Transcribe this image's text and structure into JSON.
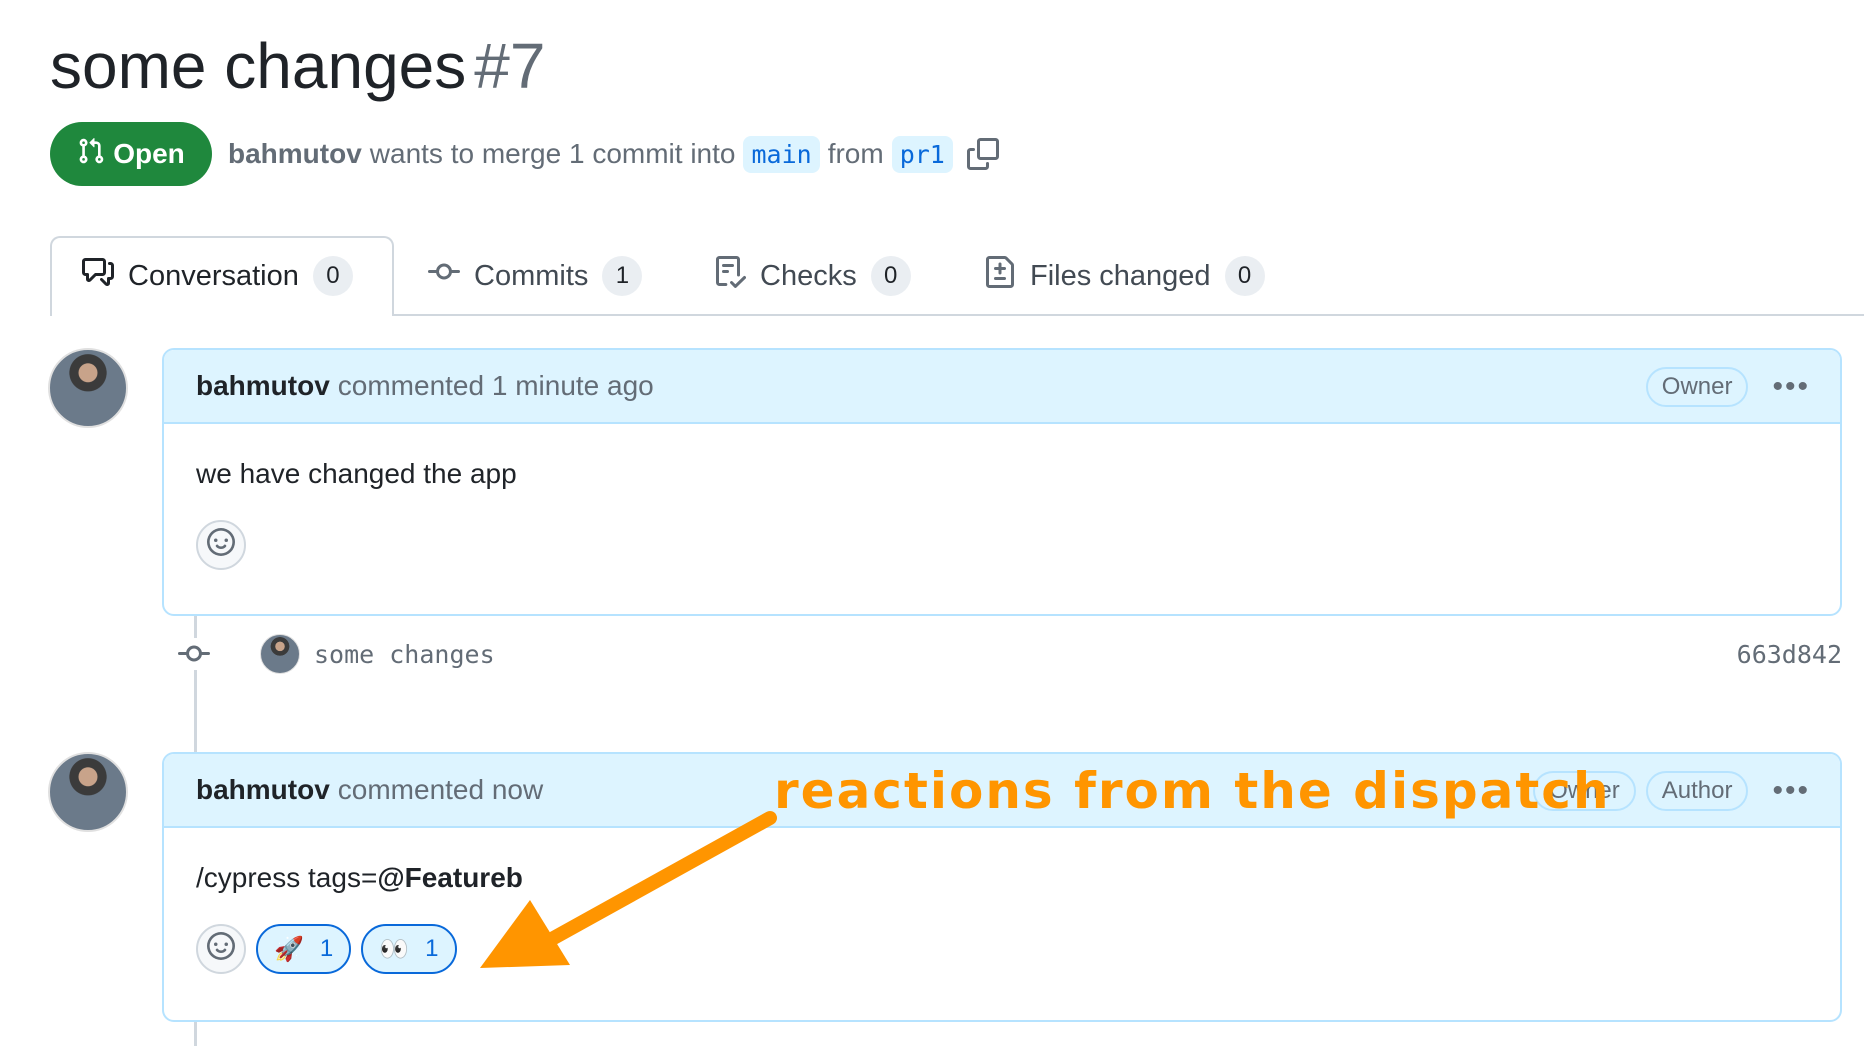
{
  "pr": {
    "title": "some changes",
    "number": "#7",
    "state": "Open",
    "author": "bahmutov",
    "merge_text": "wants to merge 1 commit into",
    "base_branch": "main",
    "from_text": "from",
    "head_branch": "pr1"
  },
  "tabs": [
    {
      "label": "Conversation",
      "count": "0"
    },
    {
      "label": "Commits",
      "count": "1"
    },
    {
      "label": "Checks",
      "count": "0"
    },
    {
      "label": "Files changed",
      "count": "0"
    }
  ],
  "comments": [
    {
      "author": "bahmutov",
      "action": "commented 1 minute ago",
      "badges": [
        "Owner"
      ],
      "body": "we have changed the app"
    },
    {
      "author": "bahmutov",
      "action": "commented now",
      "badges": [
        "Owner",
        "Author"
      ],
      "body_prefix": "/cypress tags=",
      "body_bold": "@Featureb",
      "reactions": [
        {
          "emoji": "🚀",
          "count": "1"
        },
        {
          "emoji": "👀",
          "count": "1"
        }
      ]
    }
  ],
  "commit": {
    "message": "some changes",
    "sha": "663d842"
  },
  "annotation": {
    "text": "reactions from the dispatch"
  },
  "colors": {
    "open_green": "#1f883d",
    "accent_blue": "#0969da",
    "header_blue": "#ddf4ff",
    "annotation_orange": "#ff9500"
  }
}
